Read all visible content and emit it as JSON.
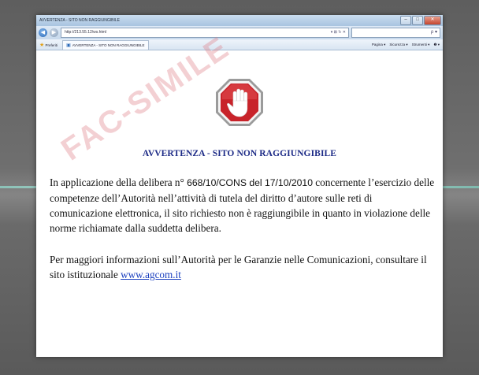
{
  "window": {
    "title": "AVVERTENZA - SITO NON RAGGIUNGIBILE",
    "controls": {
      "minimize": "–",
      "maximize": "□",
      "close": "✕"
    }
  },
  "addressbar": {
    "back": "◀",
    "forward": "▶",
    "url": "http://213.55.12/ws.html",
    "url_tools": "▾ ⊠ ↻ ✕",
    "search_icon": "ρ ▾"
  },
  "favorites": {
    "label": "Preferiti",
    "tab_title": "AVVERTENZA - SITO NON RAGGIUNGIBILE",
    "commands": [
      "Pagina ▾",
      "Sicurezza ▾",
      "Strumenti ▾",
      "❷ ▾"
    ]
  },
  "page": {
    "heading": "AVVERTENZA - SITO NON RAGGIUNGIBILE",
    "p1_a": "In applicazione della delibera n°",
    "p1_code": "668/10/CONS del 17/10/2010",
    "p1_b": " concernente l’esercizio delle competenze dell’Autorità nell’attività di tutela del diritto d’autore sulle reti di comunicazione elettronica, il sito richiesto non è raggiungibile in quanto in violazione delle norme richiamate dalla suddetta delibera.",
    "p2_a": "Per maggiori informazioni sull’Autorità per le Garanzie nelle Comunicazioni, consultare il sito istituzionale ",
    "p2_link": "www.agcom.it"
  },
  "watermark": "FAC-SIMILE",
  "colors": {
    "heading": "#1c2a86",
    "link": "#1a3fbf",
    "stop_red": "#c8232a"
  }
}
